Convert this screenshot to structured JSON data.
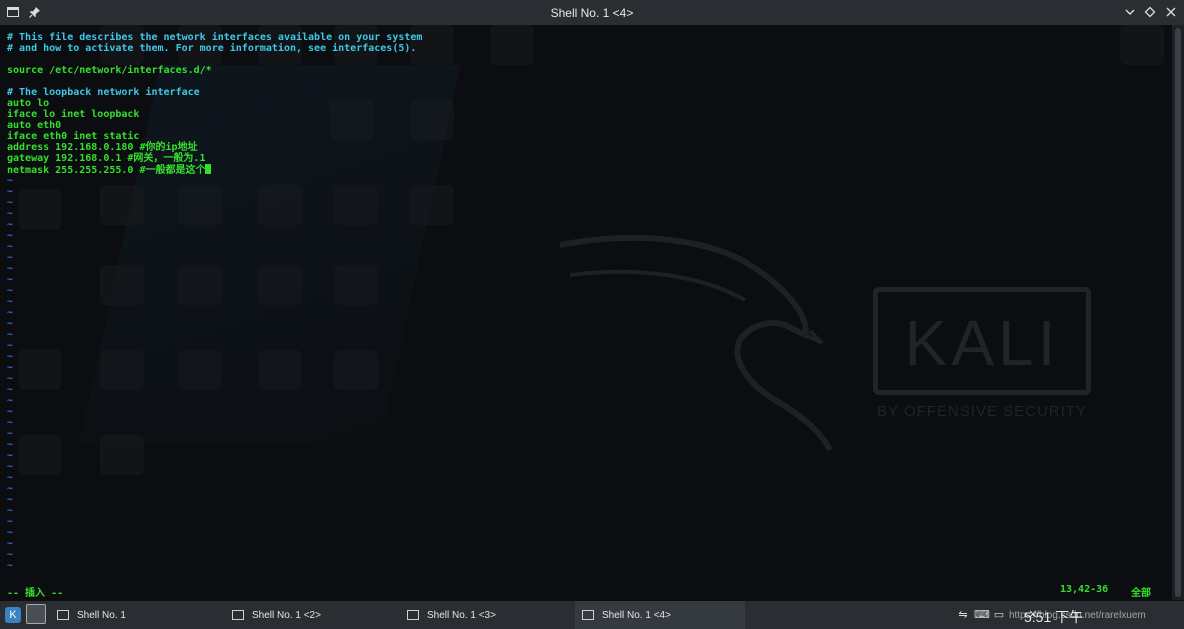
{
  "window": {
    "title": "Shell No. 1 <4>"
  },
  "editor": {
    "lines": [
      {
        "text": "# This file describes the network interfaces available on your system",
        "kind": "comment"
      },
      {
        "text": "# and how to activate them. For more information, see interfaces(5).",
        "kind": "comment"
      },
      {
        "text": "",
        "kind": "normal"
      },
      {
        "text": "source /etc/network/interfaces.d/*",
        "kind": "normal"
      },
      {
        "text": "",
        "kind": "normal"
      },
      {
        "text": "# The loopback network interface",
        "kind": "comment"
      },
      {
        "text": "auto lo",
        "kind": "normal"
      },
      {
        "text": "iface lo inet loopback",
        "kind": "normal"
      },
      {
        "text": "auto eth0",
        "kind": "normal"
      },
      {
        "text": "iface eth0 inet static",
        "kind": "normal"
      },
      {
        "text": "address 192.168.0.180 #你的ip地址",
        "kind": "normal"
      },
      {
        "text": "gateway 192.168.0.1 #网关，一般为.1",
        "kind": "normal"
      },
      {
        "text": "netmask 255.255.255.0 #一般都是这个",
        "kind": "normal",
        "cursor": true
      }
    ],
    "empty_line_marker": "~",
    "empty_line_count": 36,
    "mode": "-- 插入 --",
    "ruler": "13,42-36",
    "scroll_position": "全部"
  },
  "desktop": {
    "logo_text": "KALI",
    "logo_tagline": "BY OFFENSIVE SECURITY"
  },
  "taskbar": {
    "tasks": [
      {
        "label": "Shell No. 1",
        "active": false
      },
      {
        "label": "Shell No. 1 <2>",
        "active": false
      },
      {
        "label": "Shell No. 1 <3>",
        "active": false
      },
      {
        "label": "Shell No. 1 <4>",
        "active": true
      }
    ],
    "clock": "5:51 下午",
    "watermark": "https://blog.csdn.net/rarelxuem"
  },
  "colors": {
    "text_green": "#35e02c",
    "comment_cyan": "#3fc8e6",
    "tilde_blue": "#2f6fd6",
    "background": "#0b0d10"
  }
}
